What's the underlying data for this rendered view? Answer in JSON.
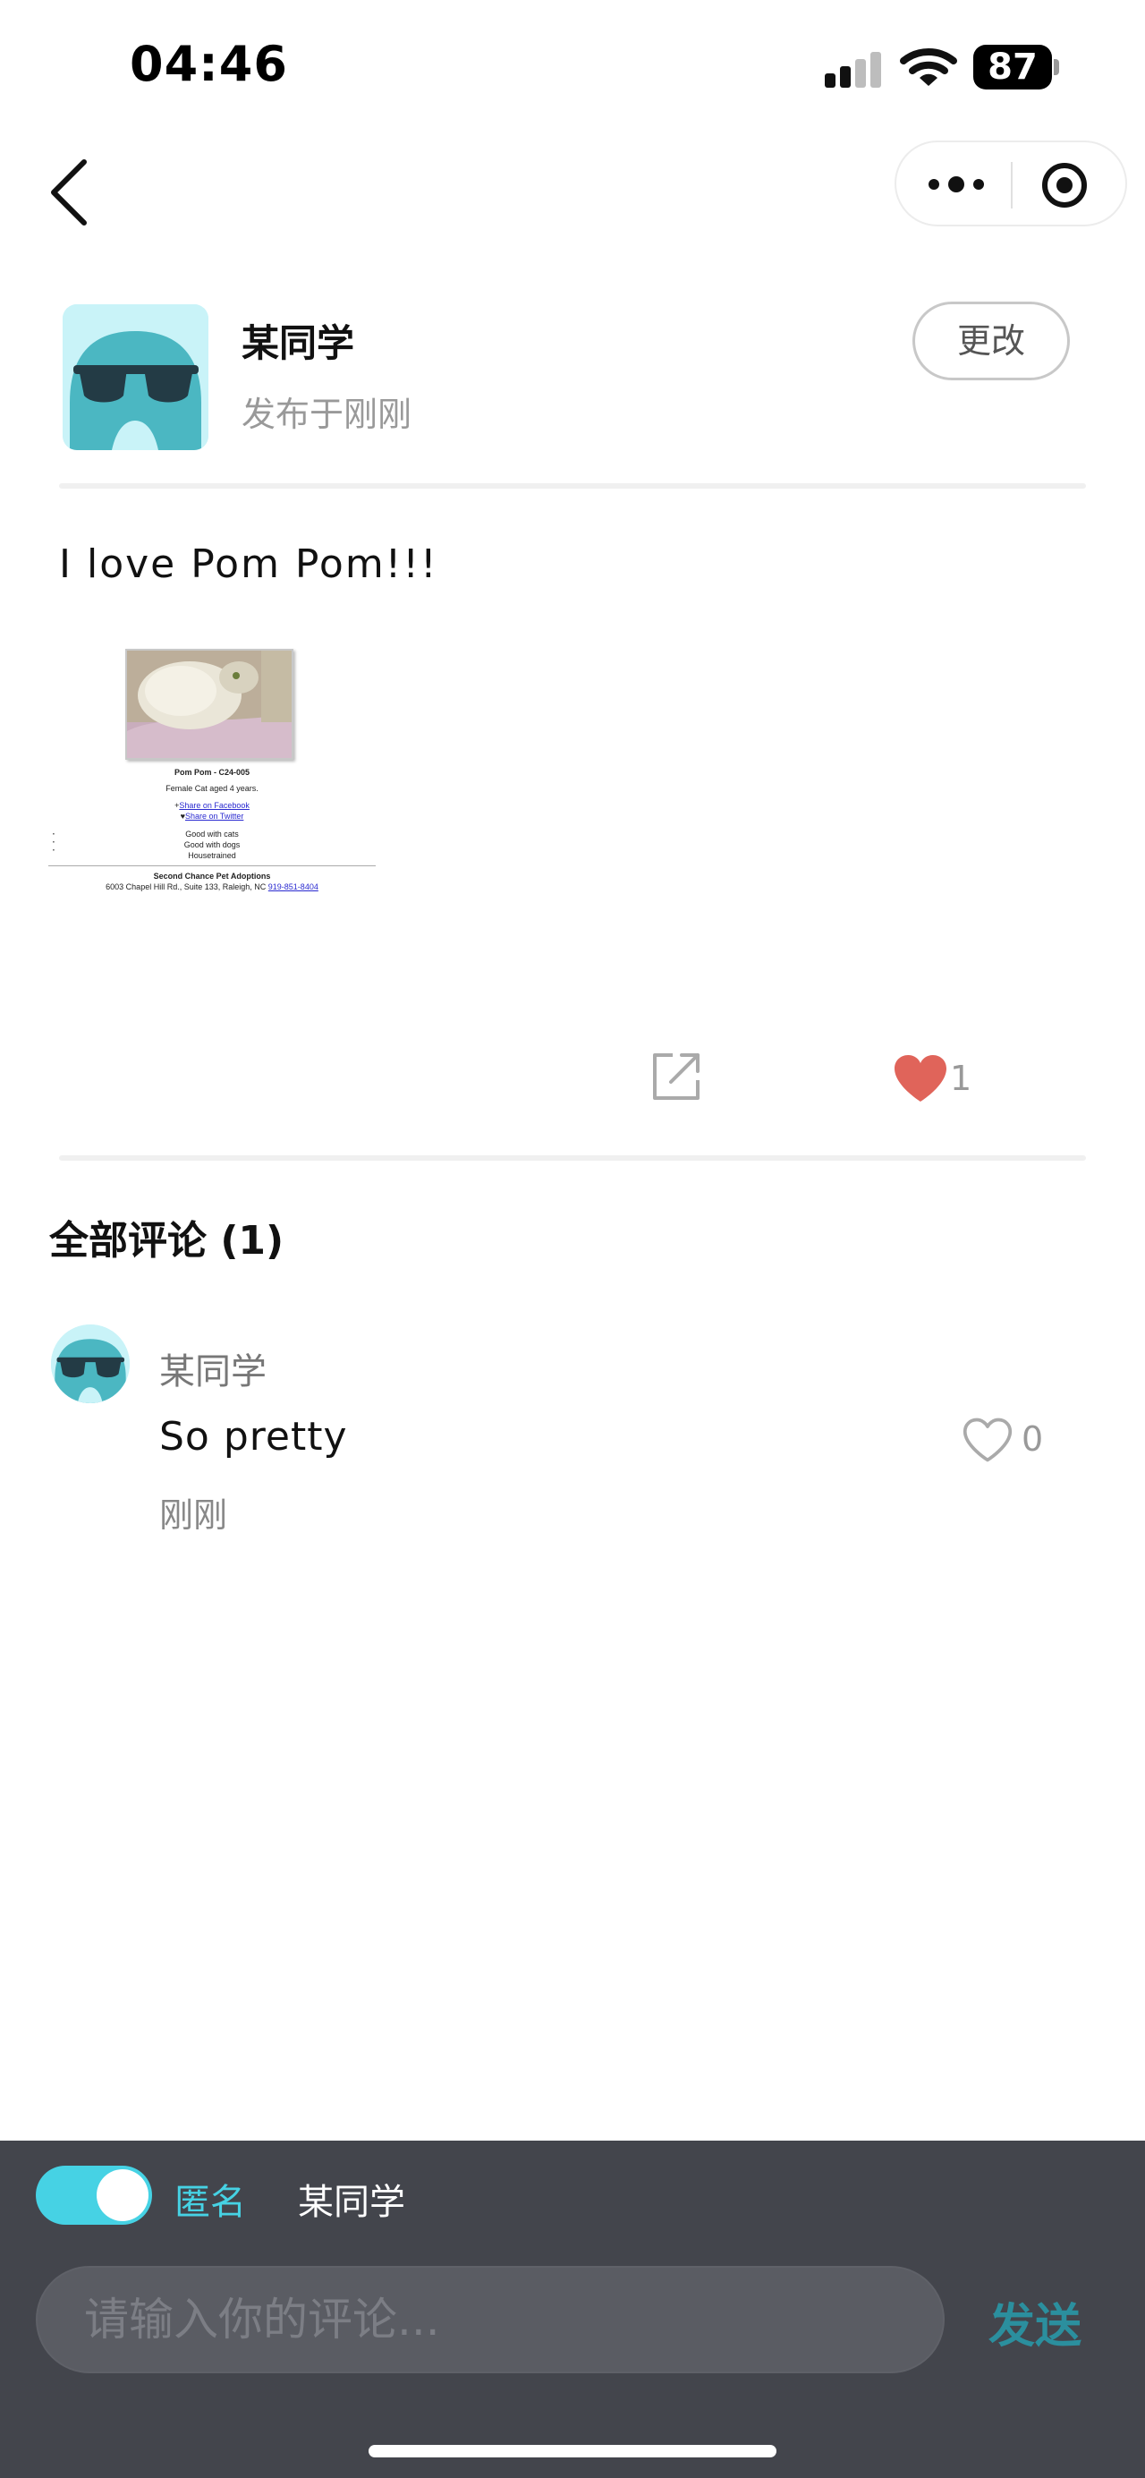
{
  "status_bar": {
    "time": "04:46",
    "battery": "87"
  },
  "post": {
    "author": "某同学",
    "time": "发布于刚刚",
    "edit_label": "更改",
    "text": "I love Pom Pom!!!",
    "attachment": {
      "title": "Pom Pom - C24-005",
      "subtitle": "Female Cat aged 4 years.",
      "share_facebook": "Share on Facebook",
      "share_twitter": "Share on Twitter",
      "traits": [
        "Good with cats",
        "Good with dogs",
        "Housetrained"
      ],
      "org_name": "Second Chance Pet Adoptions",
      "org_address": "6003 Chapel Hill Rd., Suite 133, Raleigh, NC",
      "org_phone": "919-851-8404"
    },
    "like_count": "1"
  },
  "comments": {
    "title": "全部评论 (1)",
    "items": [
      {
        "author": "某同学",
        "text": "So pretty",
        "time": "刚刚",
        "likes": "0"
      }
    ]
  },
  "composer": {
    "anonymous_label": "匿名",
    "name": "某同学",
    "placeholder": "请输入你的评论...",
    "send_label": "发送",
    "anonymous_on": true
  },
  "colors": {
    "accent": "#46d2e4",
    "like": "#e0645a",
    "bottom_bar": "#43454c"
  },
  "icons": {
    "back": "chevron-left-icon",
    "more": "more-dots-icon",
    "target": "target-circle-icon",
    "share": "share-external-icon",
    "like": "heart-icon"
  }
}
